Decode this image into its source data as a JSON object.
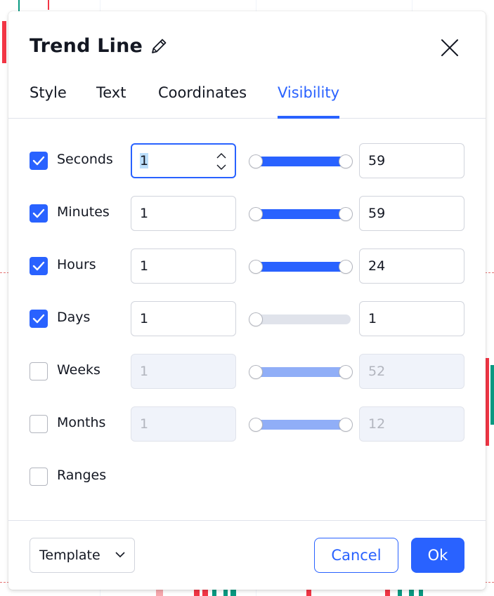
{
  "dialog": {
    "title": "Trend Line",
    "edit_icon": "pencil-icon",
    "close_icon": "close-icon"
  },
  "tabs": [
    {
      "label": "Style",
      "active": false
    },
    {
      "label": "Text",
      "active": false
    },
    {
      "label": "Coordinates",
      "active": false
    },
    {
      "label": "Visibility",
      "active": true
    }
  ],
  "visibility": [
    {
      "label": "Seconds",
      "checked": true,
      "from": "1",
      "to": "59",
      "range_min": 1,
      "range_max": 59,
      "enabled": true,
      "focused": true
    },
    {
      "label": "Minutes",
      "checked": true,
      "from": "1",
      "to": "59",
      "range_min": 1,
      "range_max": 59,
      "enabled": true
    },
    {
      "label": "Hours",
      "checked": true,
      "from": "1",
      "to": "24",
      "range_min": 1,
      "range_max": 24,
      "enabled": true
    },
    {
      "label": "Days",
      "checked": true,
      "from": "1",
      "to": "1",
      "range_min": 1,
      "range_max": 1,
      "enabled": true
    },
    {
      "label": "Weeks",
      "checked": false,
      "from": "1",
      "to": "52",
      "range_min": 1,
      "range_max": 52,
      "enabled": false
    },
    {
      "label": "Months",
      "checked": false,
      "from": "1",
      "to": "12",
      "range_min": 1,
      "range_max": 12,
      "enabled": false
    },
    {
      "label": "Ranges",
      "checked": false
    }
  ],
  "footer": {
    "template_label": "Template",
    "cancel_label": "Cancel",
    "ok_label": "Ok"
  },
  "colors": {
    "accent": "#2962ff",
    "accent_disabled": "#90aef7",
    "candle_up": "#089981",
    "candle_down": "#f23645"
  }
}
